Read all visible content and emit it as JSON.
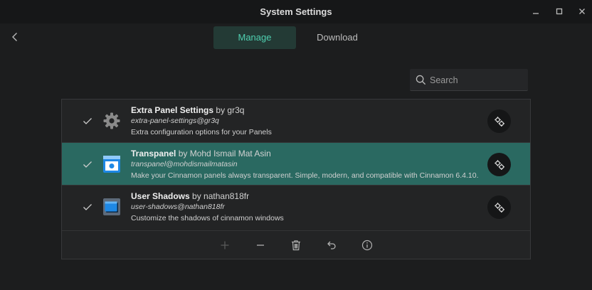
{
  "window": {
    "title": "System Settings"
  },
  "tabs": [
    {
      "label": "Manage",
      "active": true
    },
    {
      "label": "Download",
      "active": false
    }
  ],
  "search": {
    "placeholder": "Search",
    "value": ""
  },
  "extensions": [
    {
      "name": "Extra Panel Settings",
      "author": "by gr3q",
      "uuid": "extra-panel-settings@gr3q",
      "description": "Extra configuration options for your Panels",
      "icon": "gear-icon",
      "enabled": true,
      "selected": false
    },
    {
      "name": "Transpanel",
      "author": "by Mohd Ismail Mat Asin",
      "uuid": "transpanel@mohdismailmatasin",
      "description": "Make your Cinnamon panels always transparent. Simple, modern, and compatible with Cinnamon 6.4.10.",
      "icon": "transpanel-icon",
      "enabled": true,
      "selected": true
    },
    {
      "name": "User Shadows",
      "author": "by nathan818fr",
      "uuid": "user-shadows@nathan818fr",
      "description": "Customize the shadows of cinnamon windows",
      "icon": "window-shadow-icon",
      "enabled": true,
      "selected": false
    }
  ],
  "toolbar": {
    "icons": [
      "add-icon",
      "remove-icon",
      "trash-icon",
      "undo-icon",
      "info-icon"
    ]
  },
  "colors": {
    "accent": "#4fcfb0",
    "selected_row": "#2a6961",
    "background": "#1c1d1e"
  }
}
